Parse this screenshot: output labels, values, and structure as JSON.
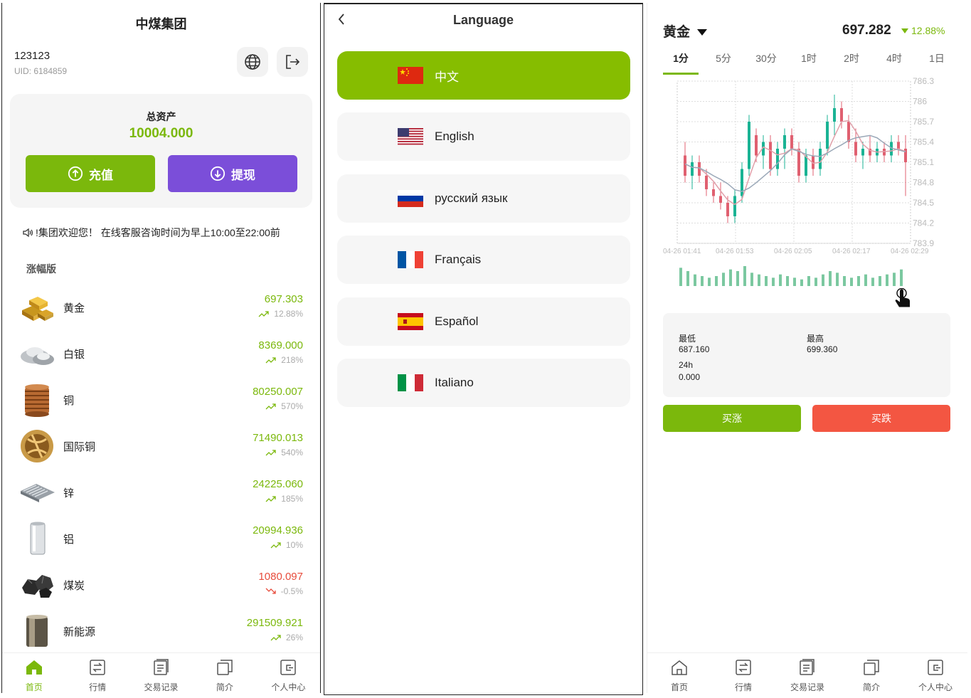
{
  "home": {
    "title": "中煤集团",
    "username": "123123",
    "uid": "UID: 6184859",
    "assets_label": "总资产",
    "assets_value": "10004.000",
    "deposit_label": "充值",
    "withdraw_label": "提现",
    "notice": "!集团欢迎您！ 在线客服咨询时间为早上10:00至22:00前",
    "section": "涨幅版",
    "items": [
      {
        "name": "黄金",
        "price": "697.303",
        "pct": "12.88%",
        "dir": "up",
        "icon": "gold-bar-icon"
      },
      {
        "name": "白银",
        "price": "8369.000",
        "pct": "218%",
        "dir": "up",
        "icon": "silver-ingot-icon"
      },
      {
        "name": "铜",
        "price": "80250.007",
        "pct": "570%",
        "dir": "up",
        "icon": "copper-coil-icon"
      },
      {
        "name": "国际铜",
        "price": "71490.013",
        "pct": "540%",
        "dir": "up",
        "icon": "copper-ball-icon"
      },
      {
        "name": "锌",
        "price": "24225.060",
        "pct": "185%",
        "dir": "up",
        "icon": "zinc-sheet-icon"
      },
      {
        "name": "铝",
        "price": "20994.936",
        "pct": "10%",
        "dir": "up",
        "icon": "aluminum-can-icon"
      },
      {
        "name": "煤炭",
        "price": "1080.097",
        "pct": "-0.5%",
        "dir": "down",
        "icon": "coal-icon"
      },
      {
        "name": "新能源",
        "price": "291509.921",
        "pct": "26%",
        "dir": "up",
        "icon": "battery-icon"
      }
    ]
  },
  "tabbar": [
    {
      "label": "首页",
      "icon": "home-icon"
    },
    {
      "label": "行情",
      "icon": "market-icon"
    },
    {
      "label": "交易记录",
      "icon": "records-icon"
    },
    {
      "label": "简介",
      "icon": "intro-icon"
    },
    {
      "label": "个人中心",
      "icon": "profile-icon"
    }
  ],
  "language": {
    "title": "Language",
    "options": [
      {
        "label": "中文",
        "flag": "cn",
        "selected": true
      },
      {
        "label": "English",
        "flag": "us",
        "selected": false
      },
      {
        "label": "русский язык",
        "flag": "ru",
        "selected": false
      },
      {
        "label": "Français",
        "flag": "fr",
        "selected": false
      },
      {
        "label": "Español",
        "flag": "es",
        "selected": false
      },
      {
        "label": "Italiano",
        "flag": "it",
        "selected": false
      }
    ]
  },
  "detail": {
    "symbol": "黄金",
    "price": "697.282",
    "change": "12.88%",
    "periods": [
      "1分",
      "5分",
      "30分",
      "1时",
      "2时",
      "4时",
      "1日"
    ],
    "active_period": "1分",
    "low_label": "最低",
    "low_value": "687.160",
    "high_label": "最高",
    "high_value": "699.360",
    "vol_label": "24h",
    "vol_value": "0.000",
    "buy_up": "买涨",
    "buy_down": "买跌"
  },
  "chart_data": {
    "type": "candlestick",
    "y_ticks": [
      "786.3",
      "786",
      "785.7",
      "785.4",
      "785.1",
      "784.8",
      "784.5",
      "784.2",
      "783.9"
    ],
    "x_ticks": [
      "04-26 01:41",
      "04-26 01:53",
      "04-26 02:05",
      "04-26 02:17",
      "04-26 02:29"
    ],
    "ylim": [
      783.9,
      786.3
    ],
    "colors": {
      "up": "#1ab394",
      "down": "#e06070"
    },
    "candles": [
      {
        "o": 785.2,
        "h": 785.4,
        "l": 784.8,
        "c": 784.9
      },
      {
        "o": 784.9,
        "h": 785.2,
        "l": 784.7,
        "c": 785.1
      },
      {
        "o": 785.1,
        "h": 785.2,
        "l": 784.8,
        "c": 784.9
      },
      {
        "o": 784.9,
        "h": 785.0,
        "l": 784.6,
        "c": 784.7
      },
      {
        "o": 784.7,
        "h": 784.8,
        "l": 784.5,
        "c": 784.6
      },
      {
        "o": 784.6,
        "h": 784.8,
        "l": 784.4,
        "c": 784.5
      },
      {
        "o": 784.5,
        "h": 784.6,
        "l": 784.2,
        "c": 784.3
      },
      {
        "o": 784.3,
        "h": 784.7,
        "l": 784.2,
        "c": 784.6
      },
      {
        "o": 784.6,
        "h": 785.1,
        "l": 784.5,
        "c": 785.0
      },
      {
        "o": 785.0,
        "h": 785.8,
        "l": 784.9,
        "c": 785.7
      },
      {
        "o": 785.5,
        "h": 785.6,
        "l": 785.1,
        "c": 785.2
      },
      {
        "o": 785.2,
        "h": 785.5,
        "l": 785.0,
        "c": 785.4
      },
      {
        "o": 785.4,
        "h": 785.5,
        "l": 784.9,
        "c": 785.0
      },
      {
        "o": 785.0,
        "h": 785.4,
        "l": 784.9,
        "c": 785.3
      },
      {
        "o": 785.3,
        "h": 785.6,
        "l": 785.0,
        "c": 785.5
      },
      {
        "o": 785.5,
        "h": 785.6,
        "l": 785.2,
        "c": 785.3
      },
      {
        "o": 785.3,
        "h": 785.4,
        "l": 784.8,
        "c": 784.9
      },
      {
        "o": 784.9,
        "h": 785.3,
        "l": 784.8,
        "c": 785.2
      },
      {
        "o": 785.2,
        "h": 785.3,
        "l": 784.9,
        "c": 785.0
      },
      {
        "o": 785.0,
        "h": 785.4,
        "l": 784.9,
        "c": 785.3
      },
      {
        "o": 785.3,
        "h": 785.8,
        "l": 785.2,
        "c": 785.7
      },
      {
        "o": 785.7,
        "h": 786.1,
        "l": 785.5,
        "c": 785.9
      },
      {
        "o": 785.9,
        "h": 786.0,
        "l": 785.6,
        "c": 785.7
      },
      {
        "o": 785.7,
        "h": 785.8,
        "l": 785.3,
        "c": 785.4
      },
      {
        "o": 785.4,
        "h": 785.6,
        "l": 785.1,
        "c": 785.2
      },
      {
        "o": 785.2,
        "h": 785.4,
        "l": 785.0,
        "c": 785.3
      },
      {
        "o": 785.3,
        "h": 785.5,
        "l": 785.1,
        "c": 785.2
      },
      {
        "o": 785.2,
        "h": 785.4,
        "l": 785.1,
        "c": 785.3
      },
      {
        "o": 785.3,
        "h": 785.4,
        "l": 785.1,
        "c": 785.2
      },
      {
        "o": 785.2,
        "h": 785.5,
        "l": 785.1,
        "c": 785.4
      },
      {
        "o": 785.4,
        "h": 785.5,
        "l": 785.2,
        "c": 785.3
      },
      {
        "o": 785.3,
        "h": 785.5,
        "l": 784.6,
        "c": 785.1
      }
    ],
    "volumes": [
      22,
      18,
      14,
      12,
      10,
      12,
      16,
      20,
      18,
      24,
      16,
      14,
      12,
      10,
      14,
      12,
      10,
      8,
      12,
      10,
      14,
      18,
      16,
      12,
      10,
      12,
      14,
      10,
      12,
      14,
      16,
      20
    ]
  }
}
